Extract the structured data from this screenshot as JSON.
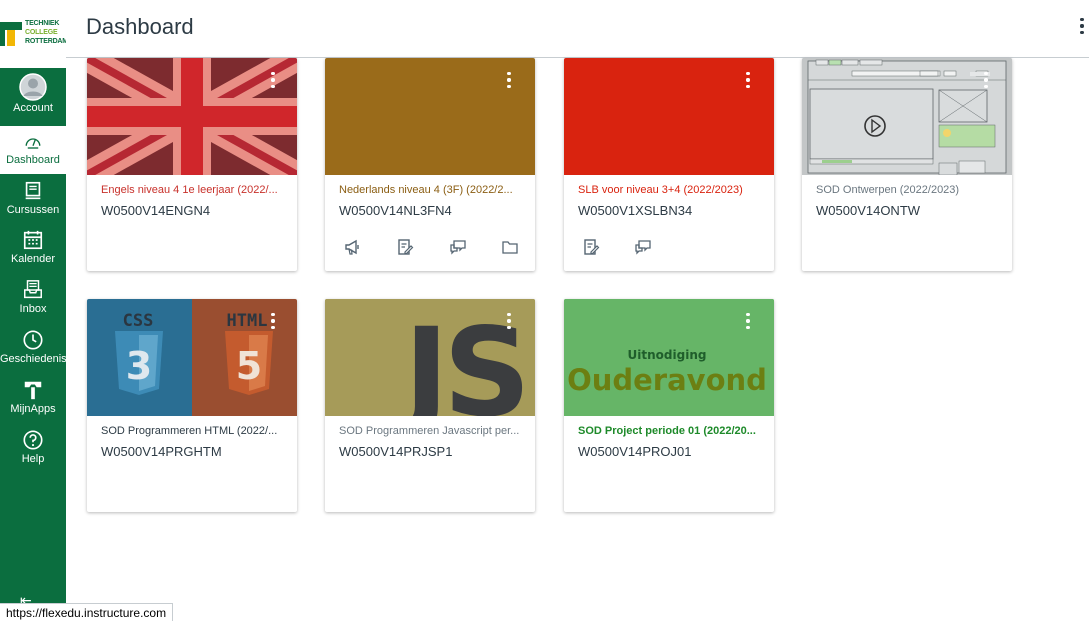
{
  "logo": {
    "line1": "TECHNIEK",
    "line2": "COLLEGE",
    "line3": "ROTTERDAM"
  },
  "sidebar": {
    "items": [
      {
        "label": "Account",
        "icon": "avatar-icon",
        "active": false
      },
      {
        "label": "Dashboard",
        "icon": "dashboard-gauge-icon",
        "active": true
      },
      {
        "label": "Cursussen",
        "icon": "book-icon",
        "active": false
      },
      {
        "label": "Kalender",
        "icon": "calendar-icon",
        "active": false
      },
      {
        "label": "Inbox",
        "icon": "inbox-icon",
        "active": false
      },
      {
        "label": "Geschiedenis",
        "icon": "clock-icon",
        "active": false
      },
      {
        "label": "MijnApps",
        "icon": "apps-logo-icon",
        "active": false
      },
      {
        "label": "Help",
        "icon": "help-icon",
        "active": false
      }
    ],
    "collapse_icon": "collapse-arrow-icon"
  },
  "header": {
    "title": "Dashboard",
    "menu_icon": "kebab-menu-icon"
  },
  "colors": {
    "brand": "#0b6e3f",
    "accent_yellow": "#f2b705",
    "card_red": "#d9230f",
    "card_brown": "#9a6b1a",
    "card_green": "#66b567"
  },
  "cards": [
    {
      "title": "Engels niveau 4 1e leerjaar (2022/...",
      "code": "W0500V14ENGN4",
      "title_color": "#c8312b",
      "hero": "union-jack",
      "actions": []
    },
    {
      "title": "Nederlands niveau 4 (3F) (2022/2...",
      "code": "W0500V14NL3FN4",
      "title_color": "#8b5e13",
      "hero": "solid-brown",
      "actions": [
        "announcement-icon",
        "assignment-icon",
        "discussion-icon",
        "files-folder-icon"
      ]
    },
    {
      "title": "SLB voor niveau 3+4 (2022/2023)",
      "code": "W0500V1XSLBN34",
      "title_color": "#d9230f",
      "hero": "solid-red",
      "actions": [
        "assignment-icon",
        "discussion-icon"
      ]
    },
    {
      "title": "SOD Ontwerpen (2022/2023)",
      "code": "W0500V14ONTW",
      "title_color": "#6b7780",
      "hero": "wireframe",
      "actions": []
    },
    {
      "title": "SOD Programmeren HTML (2022/...",
      "code": "W0500V14PRGHTM",
      "title_color": "#2d3b45",
      "hero": "css-html",
      "hero_text": [
        "CSS",
        "HTML"
      ],
      "actions": []
    },
    {
      "title": "SOD Programmeren Javascript per...",
      "code": "W0500V14PRJSP1",
      "title_color": "#6b7780",
      "hero": "js",
      "hero_text": [
        "JS"
      ],
      "actions": []
    },
    {
      "title": "SOD Project periode 01 (2022/20...",
      "code": "W0500V14PROJ01",
      "title_color": "#1e8a2a",
      "hero": "ouderavond",
      "hero_text": [
        "Uitnodiging",
        "Ouderavond"
      ],
      "actions": []
    }
  ],
  "status_bar": {
    "url": "https://flexedu.instructure.com"
  }
}
